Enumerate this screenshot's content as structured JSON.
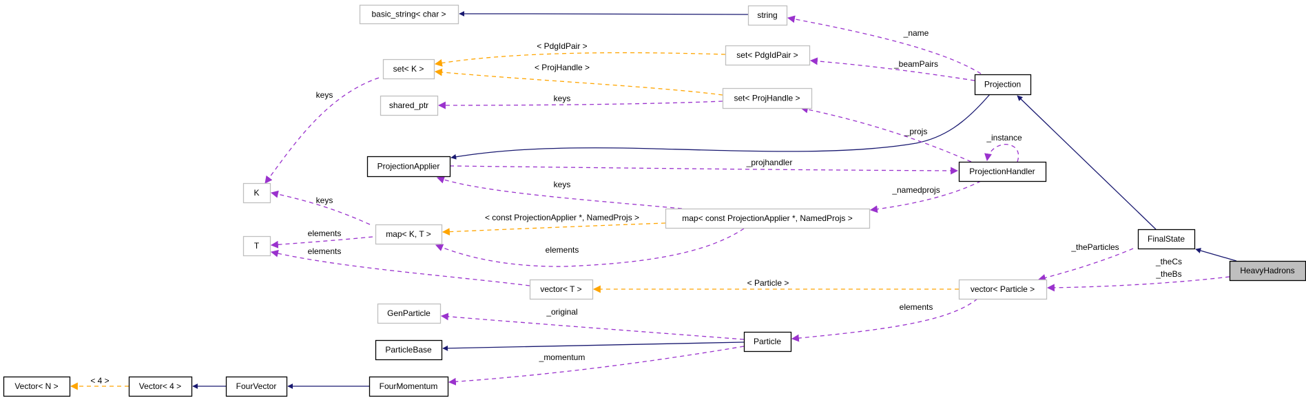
{
  "colors": {
    "inheritance": "#191970",
    "usage": "#9a32cd",
    "template": "#ffa500",
    "documented_border": "#000000",
    "undocumented_border": "#bfbfbf",
    "highlight_fill": "#bfbfbf"
  },
  "nodes": [
    {
      "id": "basic_string",
      "label": "basic_string< char >",
      "kind": "undocumented"
    },
    {
      "id": "string",
      "label": "string",
      "kind": "undocumented"
    },
    {
      "id": "set_k",
      "label": "set< K >",
      "kind": "undocumented"
    },
    {
      "id": "set_pdg",
      "label": "set< PdgIdPair >",
      "kind": "undocumented"
    },
    {
      "id": "set_proj",
      "label": "set< ProjHandle >",
      "kind": "undocumented"
    },
    {
      "id": "shared_ptr",
      "label": "shared_ptr",
      "kind": "undocumented"
    },
    {
      "id": "projection",
      "label": "Projection",
      "kind": "documented"
    },
    {
      "id": "proj_applier",
      "label": "ProjectionApplier",
      "kind": "documented"
    },
    {
      "id": "proj_handler",
      "label": "ProjectionHandler",
      "kind": "documented"
    },
    {
      "id": "k",
      "label": "K",
      "kind": "undocumented"
    },
    {
      "id": "t",
      "label": "T",
      "kind": "undocumented"
    },
    {
      "id": "map_kt",
      "label": "map< K, T >",
      "kind": "undocumented"
    },
    {
      "id": "map_const",
      "label": "map< const ProjectionApplier *, NamedProjs >",
      "kind": "undocumented"
    },
    {
      "id": "vector_t",
      "label": "vector< T >",
      "kind": "undocumented"
    },
    {
      "id": "vector_particle",
      "label": "vector< Particle >",
      "kind": "undocumented"
    },
    {
      "id": "final_state",
      "label": "FinalState",
      "kind": "documented"
    },
    {
      "id": "heavy_hadrons",
      "label": "HeavyHadrons",
      "kind": "highlight"
    },
    {
      "id": "gen_particle",
      "label": "GenParticle",
      "kind": "undocumented"
    },
    {
      "id": "particle_base",
      "label": "ParticleBase",
      "kind": "documented"
    },
    {
      "id": "particle",
      "label": "Particle",
      "kind": "documented"
    },
    {
      "id": "vector_n",
      "label": "Vector< N >",
      "kind": "documented"
    },
    {
      "id": "vector_4",
      "label": "Vector< 4 >",
      "kind": "documented"
    },
    {
      "id": "four_vector",
      "label": "FourVector",
      "kind": "documented"
    },
    {
      "id": "four_momentum",
      "label": "FourMomentum",
      "kind": "documented"
    }
  ],
  "edges": [
    {
      "from": "string",
      "to": "basic_string",
      "type": "inheritance",
      "labels": []
    },
    {
      "from": "projection",
      "to": "proj_applier",
      "type": "inheritance",
      "labels": []
    },
    {
      "from": "final_state",
      "to": "projection",
      "type": "inheritance",
      "labels": []
    },
    {
      "from": "heavy_hadrons",
      "to": "final_state",
      "type": "inheritance",
      "labels": []
    },
    {
      "from": "particle",
      "to": "particle_base",
      "type": "inheritance",
      "labels": []
    },
    {
      "from": "four_momentum",
      "to": "four_vector",
      "type": "inheritance",
      "labels": []
    },
    {
      "from": "four_vector",
      "to": "vector_4",
      "type": "inheritance",
      "labels": []
    },
    {
      "from": "set_pdg",
      "to": "set_k",
      "type": "template",
      "labels": [
        "< PdgIdPair >"
      ]
    },
    {
      "from": "set_proj",
      "to": "set_k",
      "type": "template",
      "labels": [
        "< ProjHandle >"
      ]
    },
    {
      "from": "map_const",
      "to": "map_kt",
      "type": "template",
      "labels": [
        "< const ProjectionApplier *, NamedProjs >"
      ]
    },
    {
      "from": "vector_particle",
      "to": "vector_t",
      "type": "template",
      "labels": [
        "< Particle >"
      ]
    },
    {
      "from": "vector_4",
      "to": "vector_n",
      "type": "template",
      "labels": [
        "< 4 >"
      ]
    },
    {
      "from": "projection",
      "to": "string",
      "type": "usage",
      "labels": [
        "_name"
      ]
    },
    {
      "from": "projection",
      "to": "set_pdg",
      "type": "usage",
      "labels": [
        "_beamPairs"
      ]
    },
    {
      "from": "set_proj",
      "to": "shared_ptr",
      "type": "usage",
      "labels": [
        "keys"
      ]
    },
    {
      "from": "set_k",
      "to": "k",
      "type": "usage",
      "labels": [
        "keys"
      ]
    },
    {
      "from": "proj_handler",
      "to": "set_proj",
      "type": "usage",
      "labels": [
        "_projs"
      ]
    },
    {
      "from": "proj_handler",
      "to": "proj_handler",
      "type": "usage",
      "labels": [
        "_instance"
      ]
    },
    {
      "from": "proj_applier",
      "to": "proj_handler",
      "type": "usage",
      "labels": [
        "_projhandler"
      ]
    },
    {
      "from": "proj_handler",
      "to": "map_const",
      "type": "usage",
      "labels": [
        "_namedprojs"
      ]
    },
    {
      "from": "map_const",
      "to": "proj_applier",
      "type": "usage",
      "labels": [
        "keys"
      ]
    },
    {
      "from": "map_kt",
      "to": "k",
      "type": "usage",
      "labels": [
        "keys"
      ]
    },
    {
      "from": "map_kt",
      "to": "t",
      "type": "usage",
      "labels": [
        "elements"
      ]
    },
    {
      "from": "map_const",
      "to": "map_kt",
      "type": "usage",
      "labels": [
        "elements"
      ]
    },
    {
      "from": "vector_t",
      "to": "t",
      "type": "usage",
      "labels": [
        "elements"
      ]
    },
    {
      "from": "final_state",
      "to": "vector_particle",
      "type": "usage",
      "labels": [
        "_theParticles"
      ]
    },
    {
      "from": "heavy_hadrons",
      "to": "vector_particle",
      "type": "usage",
      "labels": [
        "_theCs",
        "_theBs"
      ]
    },
    {
      "from": "vector_particle",
      "to": "particle",
      "type": "usage",
      "labels": [
        "elements"
      ]
    },
    {
      "from": "particle",
      "to": "gen_particle",
      "type": "usage",
      "labels": [
        "_original"
      ]
    },
    {
      "from": "particle",
      "to": "four_momentum",
      "type": "usage",
      "labels": [
        "_momentum"
      ]
    }
  ]
}
